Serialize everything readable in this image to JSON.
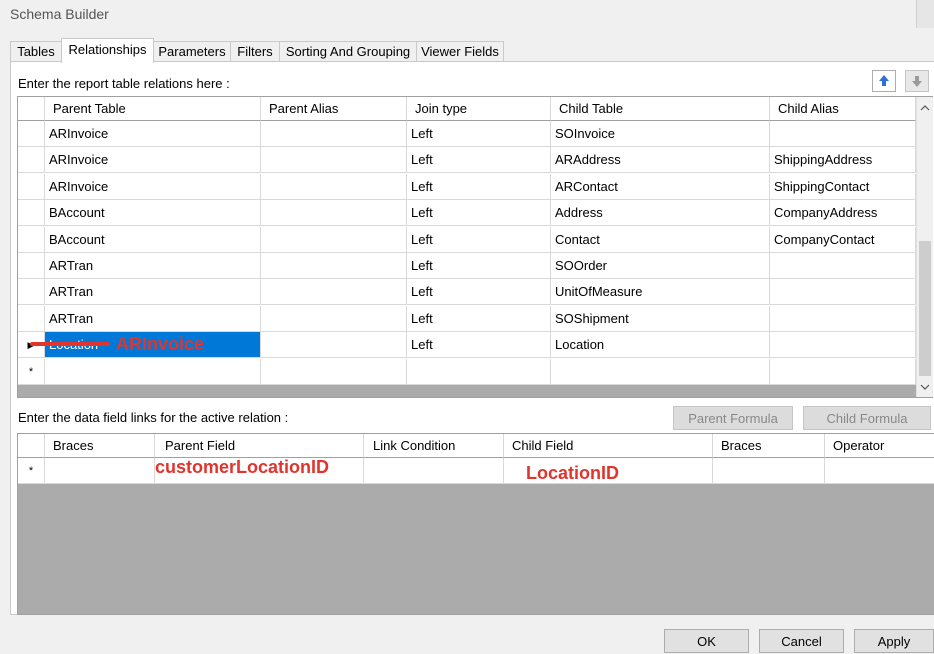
{
  "window": {
    "title": "Schema Builder"
  },
  "tabs": [
    "Tables",
    "Relationships",
    "Parameters",
    "Filters",
    "Sorting And Grouping",
    "Viewer Fields"
  ],
  "relations_section": {
    "caption": "Enter the report table relations here :",
    "columns": [
      "Parent Table",
      "Parent Alias",
      "Join type",
      "Child Table",
      "Child Alias"
    ],
    "rows": [
      [
        "ARInvoice",
        "",
        "Left",
        "SOInvoice",
        ""
      ],
      [
        "ARInvoice",
        "",
        "Left",
        "ARAddress",
        "ShippingAddress"
      ],
      [
        "ARInvoice",
        "",
        "Left",
        "ARContact",
        "ShippingContact"
      ],
      [
        "BAccount",
        "",
        "Left",
        "Address",
        "CompanyAddress"
      ],
      [
        "BAccount",
        "",
        "Left",
        "Contact",
        "CompanyContact"
      ],
      [
        "ARTran",
        "",
        "Left",
        "SOOrder",
        ""
      ],
      [
        "ARTran",
        "",
        "Left",
        "UnitOfMeasure",
        ""
      ],
      [
        "ARTran",
        "",
        "Left",
        "SOShipment",
        ""
      ],
      [
        "Location",
        "",
        "Left",
        "Location",
        ""
      ]
    ],
    "new_row_marker": "*",
    "selected_marker": "▶",
    "annotation": "ARInvoice"
  },
  "links_section": {
    "caption": "Enter the data field links for the active relation :",
    "parent_formula_label": "Parent Formula",
    "child_formula_label": "Child Formula",
    "columns": [
      "Braces",
      "Parent Field",
      "Link Condition",
      "Child Field",
      "Braces",
      "Operator"
    ],
    "new_row_marker": "*",
    "annotation_parent_field": "customerLocationID",
    "annotation_child_field": "LocationID"
  },
  "footer": {
    "ok_label": "OK",
    "cancel_label": "Cancel",
    "apply_label": "Apply"
  },
  "colors": {
    "selection": "#0078d7",
    "annotation": "#e0342d",
    "grid_empty": "#ababab"
  }
}
